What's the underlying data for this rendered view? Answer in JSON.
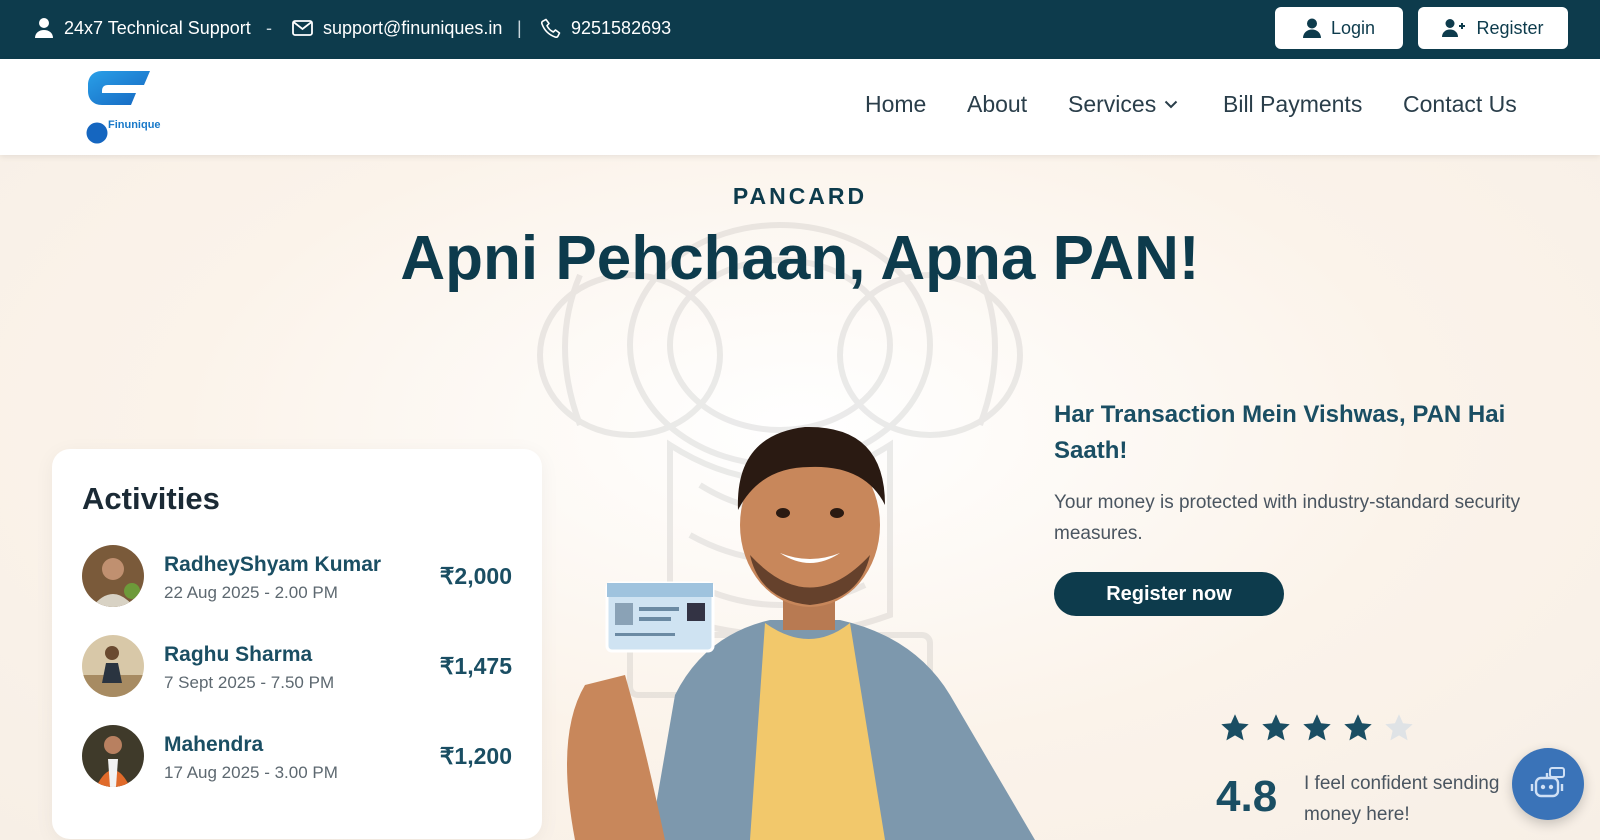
{
  "topbar": {
    "support_label": "24x7 Technical Support",
    "dash": "-",
    "email": "support@finuniques.in",
    "pipe": "|",
    "phone": "9251582693",
    "login_label": "Login",
    "register_label": "Register"
  },
  "nav": {
    "logo_text": "Finunique",
    "items": [
      {
        "label": "Home"
      },
      {
        "label": "About"
      },
      {
        "label": "Services"
      },
      {
        "label": "Bill Payments"
      },
      {
        "label": "Contact Us"
      }
    ]
  },
  "hero": {
    "eyebrow": "PANCARD",
    "headline": "Apni Pehchaan, Apna PAN!",
    "subheading": "Har Transaction Mein Vishwas, PAN Hai Saath!",
    "body": "Your money is protected with industry-standard security measures.",
    "cta_label": "Register now"
  },
  "activities": {
    "title": "Activities",
    "items": [
      {
        "name": "RadheyShyam Kumar",
        "date": "22 Aug 2025 - 2.00 PM",
        "amount": "₹2,000"
      },
      {
        "name": "Raghu Sharma",
        "date": "7 Sept 2025 - 7.50 PM",
        "amount": "₹1,475"
      },
      {
        "name": "Mahendra",
        "date": "17 Aug 2025 - 3.00 PM",
        "amount": "₹1,200"
      }
    ]
  },
  "review": {
    "stars": 4,
    "stars_max": 5,
    "rating": "4.8",
    "text": "I feel confident sending money here!"
  },
  "colors": {
    "primary": "#0d3b4c",
    "accent": "#1a4e63",
    "chatbot": "#3a73b8",
    "star_empty": "#dfe3e6"
  },
  "icons": [
    "user-icon",
    "mail-icon",
    "phone-icon",
    "login-user-icon",
    "user-plus-icon",
    "chevron-down-icon",
    "star-icon",
    "chatbot-icon"
  ]
}
